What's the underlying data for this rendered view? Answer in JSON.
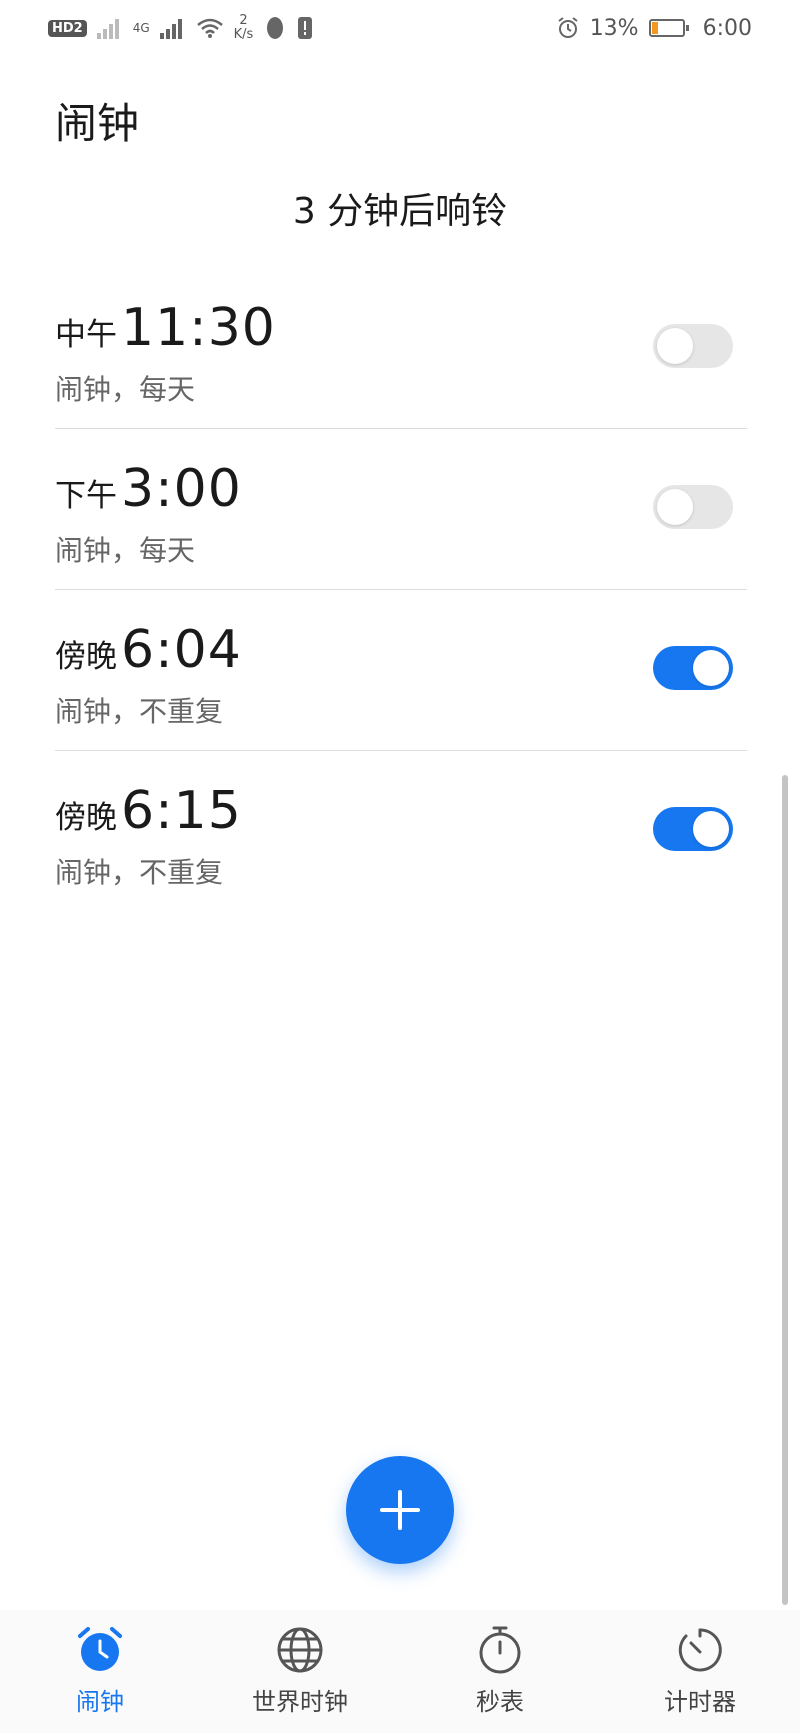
{
  "status_bar": {
    "hd": "HD",
    "sim": "2",
    "network": "4G",
    "speed_value": "2",
    "speed_unit": "K/s",
    "battery": "13%",
    "time": "6:00"
  },
  "header": {
    "title": "闹钟"
  },
  "next_alarm": "3 分钟后响铃",
  "alarms": [
    {
      "period": "中午",
      "time": "11:30",
      "subtitle": "闹钟，每天",
      "enabled": false
    },
    {
      "period": "下午",
      "time": "3:00",
      "subtitle": "闹钟，每天",
      "enabled": false
    },
    {
      "period": "傍晚",
      "time": "6:04",
      "subtitle": "闹钟，不重复",
      "enabled": true
    },
    {
      "period": "傍晚",
      "time": "6:15",
      "subtitle": "闹钟，不重复",
      "enabled": true
    }
  ],
  "nav": {
    "items": [
      {
        "label": "闹钟",
        "icon": "alarm-clock-icon",
        "active": true
      },
      {
        "label": "世界时钟",
        "icon": "globe-icon",
        "active": false
      },
      {
        "label": "秒表",
        "icon": "stopwatch-icon",
        "active": false
      },
      {
        "label": "计时器",
        "icon": "timer-icon",
        "active": false
      }
    ]
  },
  "colors": {
    "accent": "#1677f0",
    "toggle_off": "#e6e6e6",
    "battery_low": "#f39a1e"
  }
}
